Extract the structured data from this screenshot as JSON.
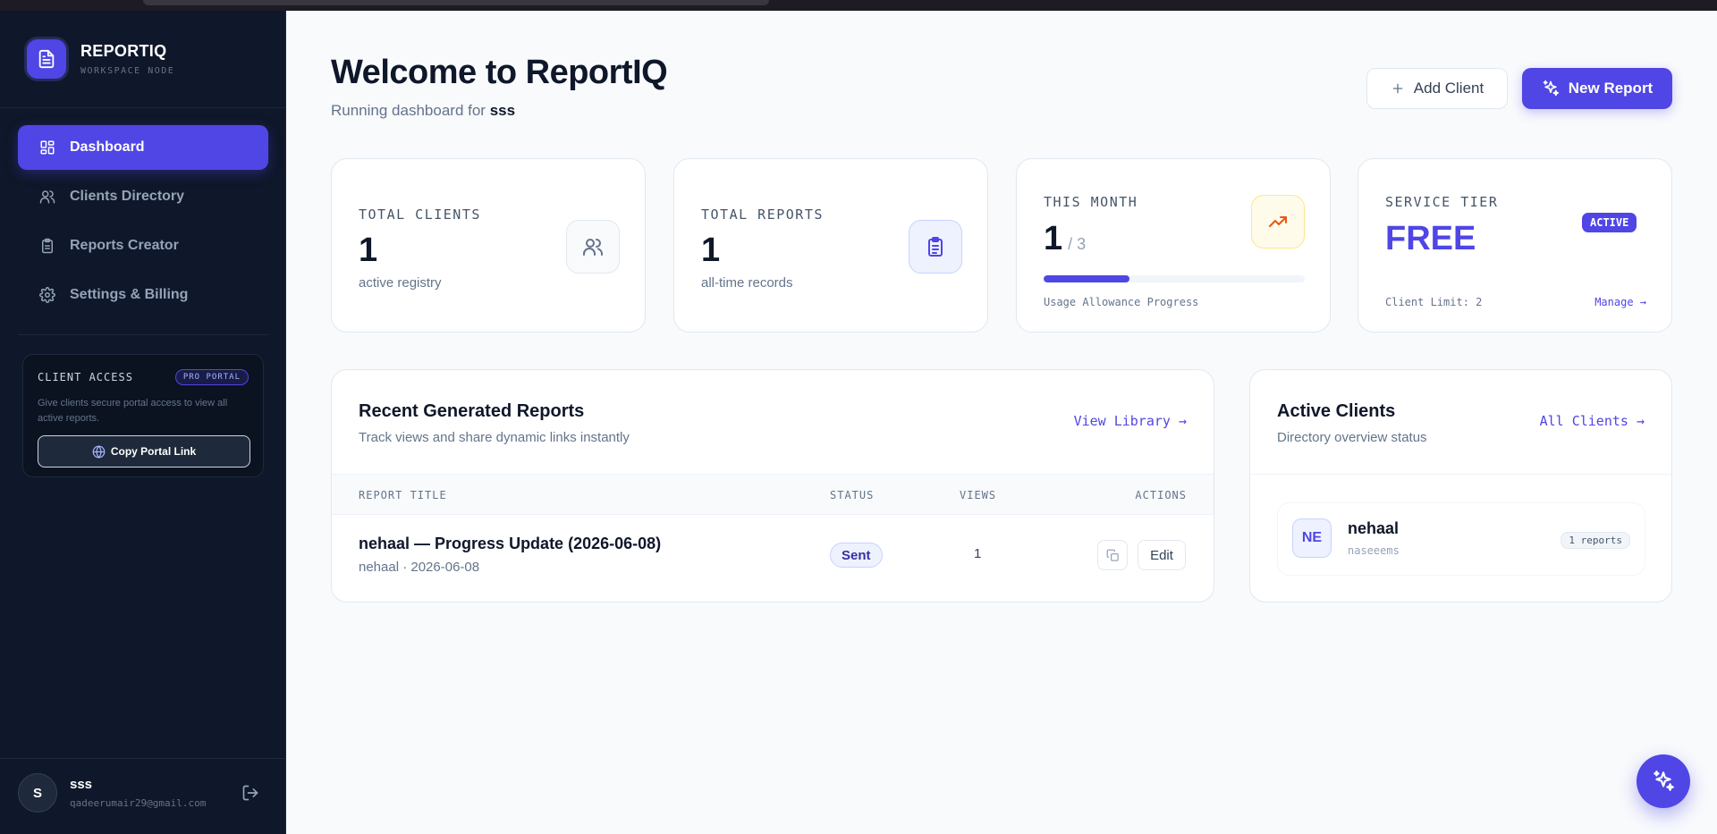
{
  "brand": {
    "name": "REPORTIQ",
    "subtitle": "WORKSPACE NODE"
  },
  "sidebar": {
    "items": [
      {
        "label": "Dashboard",
        "icon": "dashboard-grid-icon",
        "active": true
      },
      {
        "label": "Clients Directory",
        "icon": "users-icon",
        "active": false
      },
      {
        "label": "Reports Creator",
        "icon": "clipboard-icon",
        "active": false
      },
      {
        "label": "Settings & Billing",
        "icon": "gear-icon",
        "active": false
      }
    ],
    "client_access": {
      "title": "CLIENT ACCESS",
      "badge": "PRO PORTAL",
      "description": "Give clients secure portal access to view all active reports.",
      "button_label": "Copy Portal Link"
    },
    "user": {
      "initial": "S",
      "name": "sss",
      "email": "qadeerumair29@gmail.com"
    }
  },
  "header": {
    "title": "Welcome to ReportIQ",
    "subtitle_prefix": "Running dashboard for",
    "workspace": "sss",
    "add_client_label": "Add Client",
    "new_report_label": "New Report"
  },
  "stats": {
    "total_clients": {
      "label": "TOTAL CLIENTS",
      "value": "1",
      "note": "active registry"
    },
    "total_reports": {
      "label": "TOTAL REPORTS",
      "value": "1",
      "note": "all-time records"
    },
    "this_month": {
      "label": "THIS MONTH",
      "value": "1",
      "max": "/ 3",
      "progress": 0.33,
      "note": "Usage Allowance Progress"
    },
    "service_tier": {
      "label": "SERVICE TIER",
      "value": "FREE",
      "badge": "ACTIVE",
      "limit": "Client Limit: 2",
      "manage": "Manage →"
    }
  },
  "reports_panel": {
    "title": "Recent Generated Reports",
    "subtitle": "Track views and share dynamic links instantly",
    "link": "View Library →",
    "columns": [
      "REPORT TITLE",
      "STATUS",
      "VIEWS",
      "ACTIONS"
    ],
    "rows": [
      {
        "title": "nehaal — Progress Update (2026-06-08)",
        "meta": "nehaal · 2026-06-08",
        "status": "Sent",
        "views": "1",
        "edit_label": "Edit"
      }
    ]
  },
  "clients_panel": {
    "title": "Active Clients",
    "subtitle": "Directory overview status",
    "link": "All Clients →",
    "rows": [
      {
        "initials": "NE",
        "name": "nehaal",
        "handle": "naseeems",
        "reports": "1 reports"
      }
    ]
  },
  "colors": {
    "accent": "#4f46e5",
    "sidebar_bg": "#0f172a",
    "page_bg": "#f8fafc"
  }
}
